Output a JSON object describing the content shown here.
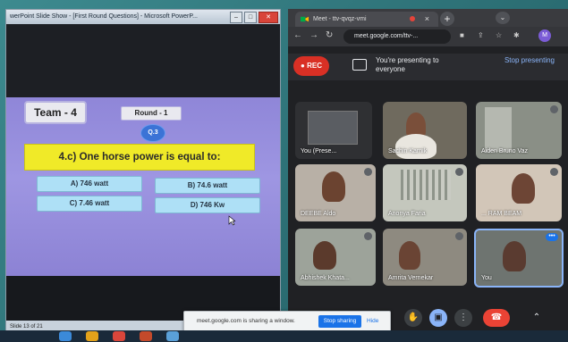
{
  "ppt": {
    "title": "werPoint Slide Show - [First Round Questions] - Microsoft PowerP...",
    "status": "Slide 13 of 21"
  },
  "slide": {
    "team": "Team - 4",
    "round": "Round - 1",
    "qnum": "Q.3",
    "question": "4.c) One horse power is equal to:",
    "options": [
      "A) 746 watt",
      "B) 74.6 watt",
      "C) 7.46 watt",
      "D) 746 Kw"
    ]
  },
  "meet": {
    "tab_title": "Meet - ttv-qvqz-vmi",
    "url": "meet.google.com/ttv-...",
    "rec": "REC",
    "presenting": "You're presenting to everyone",
    "stop": "Stop presenting",
    "participants": [
      "You (Prese...",
      "Sachin Karnik",
      "Aiden Bruno Vaz",
      "DEEBE Aldo",
      "Anonya Faria",
      "... RAM BEAM",
      "Abhishek Khata...",
      "Amrita Vernekar",
      "You"
    ]
  },
  "share": {
    "text": "meet.google.com is sharing a window.",
    "stop": "Stop sharing",
    "hide": "Hide"
  },
  "colors": {
    "question_bg": "#f0ea28",
    "option_bg": "#aee0f6",
    "slide_bg": "#9e96e2",
    "rec": "#d93025",
    "end_call": "#ea4335",
    "link": "#8ab4f8"
  },
  "icons": [
    "minimize-icon",
    "maximize-icon",
    "close-icon",
    "meet-tab-icon",
    "plus-icon",
    "back-icon",
    "forward-icon",
    "reload-icon",
    "present-icon",
    "mic-icon",
    "hand-icon",
    "more-icon",
    "end-call-icon",
    "chevron-up-icon"
  ]
}
